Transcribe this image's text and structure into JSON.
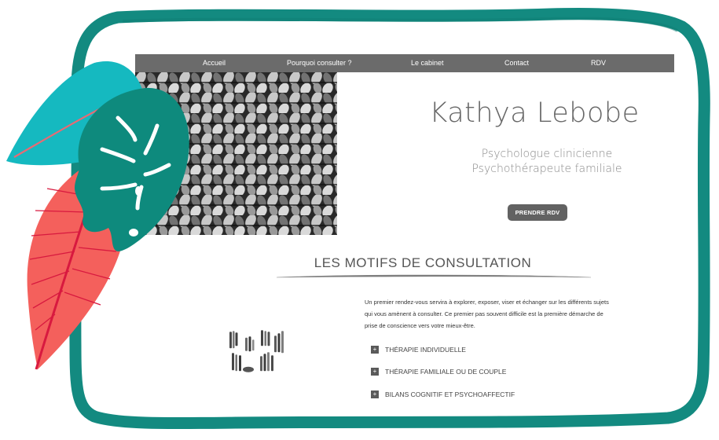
{
  "nav": {
    "items": [
      "Accueil",
      "Pourquoi consulter ?",
      "Le cabinet",
      "Contact",
      "RDV"
    ]
  },
  "hero": {
    "name": "Kathya Lebobe",
    "subtitle_line1": "Psychologue clinicienne",
    "subtitle_line2": "Psychothérapeute familiale",
    "cta_label": "PRENDRE RDV"
  },
  "section": {
    "title": "LES MOTIFS DE CONSULTATION",
    "intro": "Un premier rendez-vous servira à explorer, exposer, viser et échanger sur les différents sujets qui vous amènent à consulter. Ce premier pas souvent difficile est la première démarche de prise de conscience vers votre mieux-être.",
    "motifs": [
      {
        "icon": "+",
        "label": "THÉRAPIE INDIVIDUELLE"
      },
      {
        "icon": "+",
        "label": "THÉRAPIE FAMILIALE OU DE COUPLE"
      },
      {
        "icon": "+",
        "label": "BILANS COGNITIF ET PSYCHOAFFECTIF"
      }
    ]
  },
  "colors": {
    "frame": "#138a80",
    "nav_bg": "#6b6b6b",
    "cta_bg": "#626262",
    "leaf_cyan": "#15b9c0",
    "leaf_teal": "#0e8a7d",
    "leaf_coral": "#f4605c"
  }
}
